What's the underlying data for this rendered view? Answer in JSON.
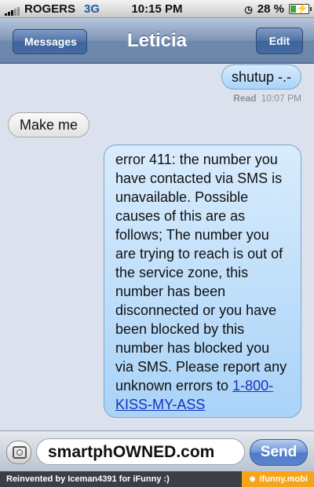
{
  "status_bar": {
    "carrier": "ROGERS",
    "network": "3G",
    "time": "10:15 PM",
    "battery": "28 %",
    "battery_level": 0.28
  },
  "nav": {
    "back_label": "Messages",
    "title": "Leticia",
    "edit_label": "Edit"
  },
  "messages": [
    {
      "from": "me",
      "text": "shutup -.-"
    },
    {
      "from": "them",
      "text": "Make me"
    },
    {
      "from": "me",
      "text": "error 411: the number you have contacted via SMS is unavailable. Possible causes of this are as follows; The number you are trying to reach is out of the service zone, this number has been disconnected or you have been blocked by this number has blocked you via SMS. Please report any unknown errors to ",
      "link": "1-800-KISS-MY-ASS"
    }
  ],
  "receipt": {
    "label": "Read",
    "time": "10:07 PM"
  },
  "composer": {
    "value": "smartphOWNED.com",
    "send_label": "Send"
  },
  "footer": {
    "credit": "Reinvented by Iceman4391 for iFunny :)",
    "site": "☻ ifunny.mobi"
  }
}
